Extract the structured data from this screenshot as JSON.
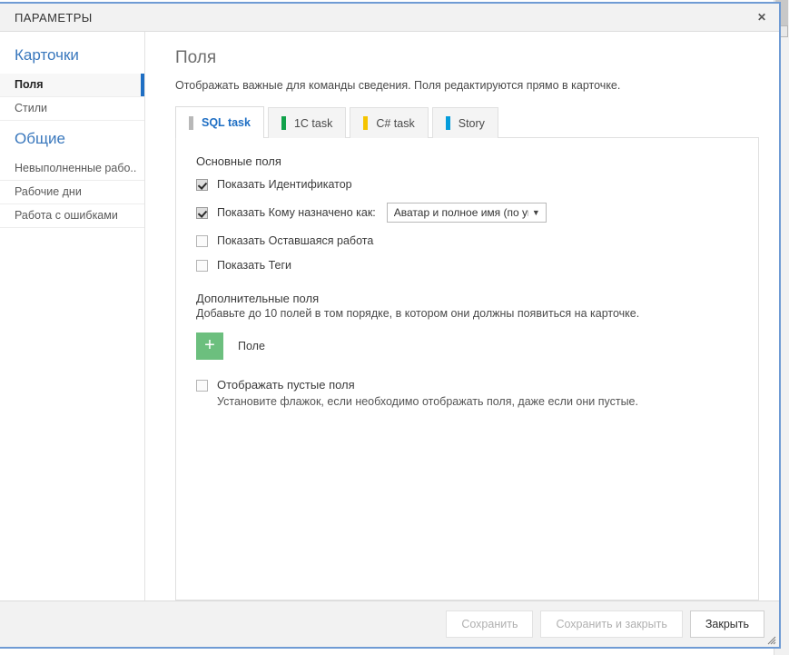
{
  "window": {
    "title": "ПАРАМЕТРЫ",
    "close_icon": "close-icon",
    "close_glyph": "✕"
  },
  "sidebar": {
    "groups": [
      {
        "title": "Карточки",
        "items": [
          {
            "label": "Поля",
            "active": true
          },
          {
            "label": "Стили",
            "active": false
          }
        ]
      },
      {
        "title": "Общие",
        "items": [
          {
            "label": "Невыполненные рабо..",
            "active": false
          },
          {
            "label": "Рабочие дни",
            "active": false
          },
          {
            "label": "Работа с ошибками",
            "active": false
          }
        ]
      }
    ]
  },
  "main": {
    "title": "Поля",
    "subtitle": "Отображать важные для команды сведения. Поля редактируются прямо в карточке.",
    "tabs": [
      {
        "label": "SQL task",
        "color": "#b8b8b8",
        "active": true
      },
      {
        "label": "1C task",
        "color": "#11a24a",
        "active": false
      },
      {
        "label": "C# task",
        "color": "#f5c400",
        "active": false
      },
      {
        "label": "Story",
        "color": "#049cdb",
        "active": false
      }
    ],
    "basic_fields": {
      "section_title": "Основные поля",
      "items": [
        {
          "label": "Показать Идентификатор",
          "checked": true
        },
        {
          "label": "Показать Кому назначено как:",
          "checked": true
        },
        {
          "label": "Показать Оставшаяся работа",
          "checked": false
        },
        {
          "label": "Показать Теги",
          "checked": false
        }
      ],
      "assigned_select": {
        "value": "Аватар и полное имя (по умс",
        "caret": "▼"
      }
    },
    "extra_fields": {
      "section_title": "Дополнительные поля",
      "section_desc": "Добавьте до 10 полей в том порядке, в котором они должны появиться на карточке.",
      "add_button_glyph": "+",
      "add_button_label": "Поле"
    },
    "empty_fields": {
      "label": "Отображать пустые поля",
      "description": "Установите флажок, если необходимо отображать поля, даже если они пустые.",
      "checked": false
    }
  },
  "footer": {
    "save": "Сохранить",
    "save_and_close": "Сохранить и закрыть",
    "close": "Закрыть"
  },
  "colors": {
    "accent_blue": "#1f6fc4",
    "green": "#6cbf7e",
    "frame_blue": "#6f9bd4"
  }
}
